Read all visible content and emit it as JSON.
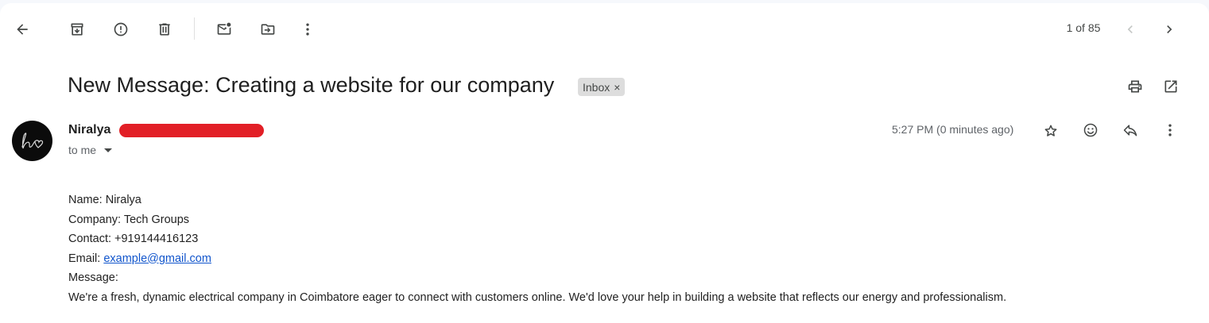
{
  "toolbar": {
    "back_icon": "arrow-back-icon",
    "archive_icon": "archive-icon",
    "report_spam_icon": "report-spam-icon",
    "delete_icon": "trash-icon",
    "mark_unread_icon": "mark-unread-icon",
    "move_to_icon": "move-to-folder-icon",
    "more_icon": "more-vert-icon"
  },
  "pager": {
    "text": "1 of 85"
  },
  "email": {
    "subject": "New Message: Creating a website for our company",
    "label": "Inbox",
    "label_remove": "×",
    "sender_name": "Niralya",
    "recipient_text": "to me",
    "timestamp": "5:27 PM (0 minutes ago)",
    "body": {
      "name_line": "Name: Niralya",
      "company_line": "Company: Tech Groups",
      "contact_line": "Contact: +919144416123",
      "email_label": "Email: ",
      "email_link": "example@gmail.com",
      "message_label": "Message:",
      "message_text": "We're a fresh, dynamic electrical company in Coimbatore eager to connect with customers online. We'd love your help in building a website that reflects our energy and professionalism."
    }
  },
  "colors": {
    "redaction": "#e21f26",
    "link": "#1155cc",
    "chip_bg": "#dddddd"
  }
}
